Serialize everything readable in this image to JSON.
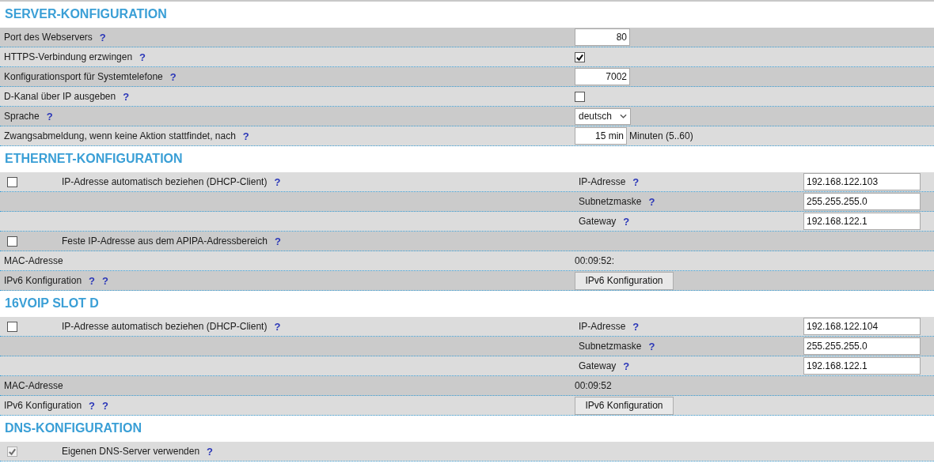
{
  "sections": [
    {
      "title": "SERVER-KONFIGURATION",
      "rows": [
        {
          "kind": "input",
          "label": "Port des Webservers",
          "help": [
            "?"
          ],
          "value": "80"
        },
        {
          "kind": "checkbox",
          "label": "HTTPS-Verbindung erzwingen",
          "help": [
            "?"
          ],
          "checked": true,
          "disabled": false
        },
        {
          "kind": "input",
          "label": "Konfigurationsport für Systemtelefone",
          "help": [
            "?"
          ],
          "value": "7002"
        },
        {
          "kind": "checkbox",
          "label": "D-Kanal über IP ausgeben",
          "help": [
            "?"
          ],
          "checked": false,
          "disabled": false
        },
        {
          "kind": "select",
          "label": "Sprache",
          "help": [
            "?"
          ],
          "value": "deutsch"
        },
        {
          "kind": "input",
          "label": "Zwangsabmeldung, wenn keine Aktion stattfindet, nach",
          "help": [
            "?"
          ],
          "value": "15 min",
          "unit": "Minuten (5..60)"
        }
      ]
    },
    {
      "title": "ETHERNET-KONFIGURATION",
      "rows": [
        {
          "kind": "dhcp",
          "label": "IP-Adresse automatisch beziehen (DHCP-Client)",
          "help": [
            "?"
          ],
          "checked": false,
          "disabled": false,
          "right_label": "IP-Adresse",
          "right_help": "?",
          "value": "192.168.122.103"
        },
        {
          "kind": "sub",
          "right_label": "Subnetzmaske",
          "right_help": "?",
          "value": "255.255.255.0"
        },
        {
          "kind": "sub",
          "right_label": "Gateway",
          "right_help": "?",
          "value": "192.168.122.1"
        },
        {
          "kind": "check-label",
          "label": "Feste IP-Adresse aus dem APIPA-Adressbereich",
          "help": [
            "?"
          ],
          "checked": false,
          "disabled": false
        },
        {
          "kind": "text",
          "label": "MAC-Adresse",
          "value": "00:09:52:"
        },
        {
          "kind": "button",
          "label": "IPv6 Konfiguration",
          "help": [
            "?",
            "?"
          ],
          "button": "IPv6 Konfiguration"
        }
      ]
    },
    {
      "title": "16VOIP SLOT D",
      "rows": [
        {
          "kind": "dhcp",
          "label": "IP-Adresse automatisch beziehen (DHCP-Client)",
          "help": [
            "?"
          ],
          "checked": false,
          "disabled": false,
          "right_label": "IP-Adresse",
          "right_help": "?",
          "value": "192.168.122.104"
        },
        {
          "kind": "sub",
          "right_label": "Subnetzmaske",
          "right_help": "?",
          "value": "255.255.255.0"
        },
        {
          "kind": "sub",
          "right_label": "Gateway",
          "right_help": "?",
          "value": "192.168.122.1"
        },
        {
          "kind": "text",
          "label": "MAC-Adresse",
          "value": "00:09:52"
        },
        {
          "kind": "button",
          "label": "IPv6 Konfiguration",
          "help": [
            "?",
            "?"
          ],
          "button": "IPv6 Konfiguration"
        }
      ]
    },
    {
      "title": "DNS-KONFIGURATION",
      "rows": [
        {
          "kind": "check-label",
          "label": "Eigenen DNS-Server verwenden",
          "help": [
            "?"
          ],
          "checked": true,
          "disabled": true
        }
      ]
    }
  ]
}
